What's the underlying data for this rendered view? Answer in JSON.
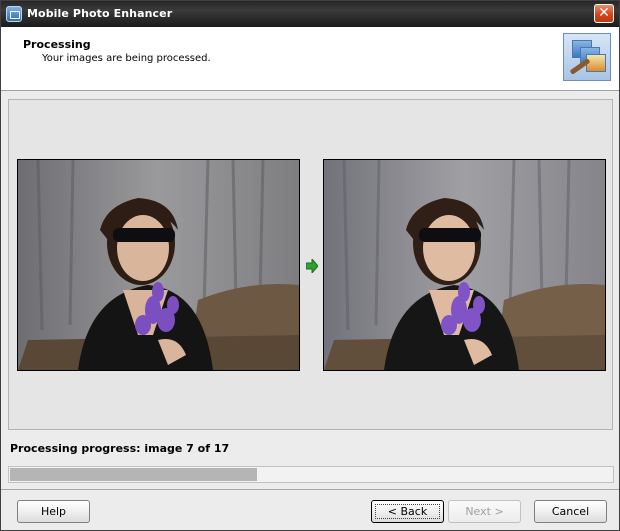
{
  "window": {
    "title": "Mobile Photo Enhancer",
    "app_icon": "photo-enhancer-app-icon",
    "close_icon": "close-icon"
  },
  "header": {
    "title": "Processing",
    "subtitle": "Your images are being processed.",
    "icon": "photo-stack-wand-icon"
  },
  "preview": {
    "original_image": "original-photo",
    "enhanced_image": "enhanced-photo",
    "arrow_icon": "green-arrow-right-icon",
    "arrow_color": "#2fa12f"
  },
  "progress": {
    "label": "Processing progress: image 7 of 17",
    "current": 7,
    "total": 17,
    "fill_fraction": 0.41
  },
  "buttons": {
    "help": "Help",
    "back": "< Back",
    "next": "Next >",
    "cancel": "Cancel"
  },
  "colors": {
    "title_bar": "#262626",
    "close_button": "#d2461c",
    "panel_background": "#ececec",
    "progress_fill": "#b5b5b5"
  }
}
